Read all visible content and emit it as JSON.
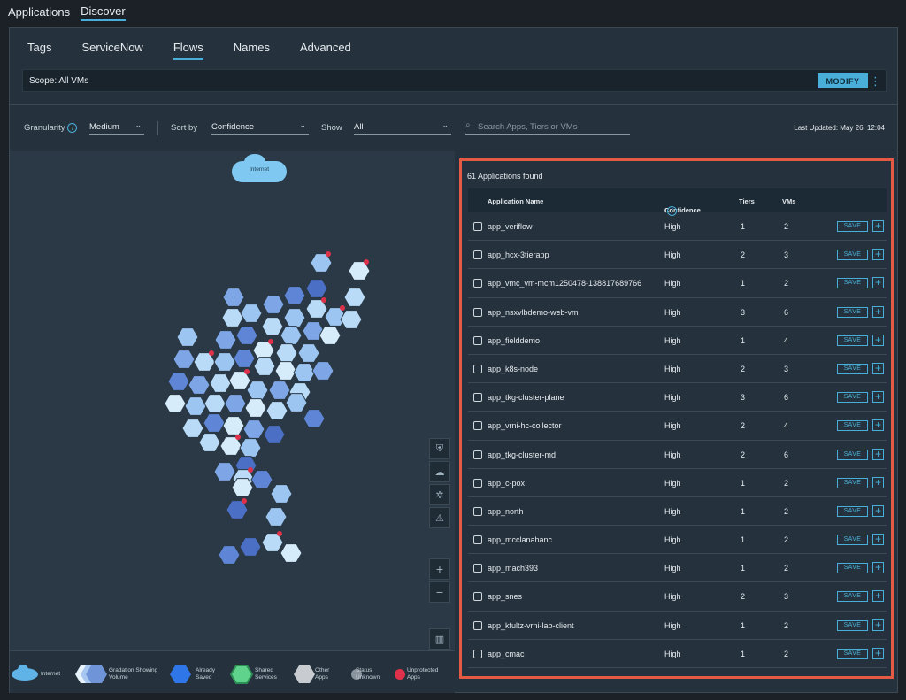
{
  "top_nav": {
    "applications": "Applications",
    "discover": "Discover"
  },
  "tabs": [
    {
      "label": "Tags"
    },
    {
      "label": "ServiceNow"
    },
    {
      "label": "Flows"
    },
    {
      "label": "Names"
    },
    {
      "label": "Advanced"
    }
  ],
  "scope": {
    "label": "Scope: All VMs",
    "modify_label": "MODIFY"
  },
  "filters": {
    "granularity_label": "Granularity",
    "granularity_value": "Medium",
    "sort_label": "Sort by",
    "sort_value": "Confidence",
    "show_label": "Show",
    "show_value": "All",
    "search_placeholder": "Search Apps, Tiers or VMs",
    "last_updated": "Last Updated: May 26, 12:04"
  },
  "map": {
    "internet_label": "Internet"
  },
  "legend": {
    "internet": "Internet",
    "gradation": "Gradation Showing Volume",
    "saved": "Already Saved",
    "shared": "Shared Services",
    "other": "Other Apps",
    "unknown": "Status Unknown",
    "unprotected": "Unprotected Apps"
  },
  "panel": {
    "found": "61 Applications found",
    "headers": {
      "name": "Application Name",
      "confidence": "Confidence",
      "tiers": "Tiers",
      "vms": "VMs"
    },
    "save_label": "SAVE",
    "rows": [
      {
        "name": "app_veriflow",
        "confidence": "High",
        "tiers": "1",
        "vms": "2"
      },
      {
        "name": "app_hcx-3tierapp",
        "confidence": "High",
        "tiers": "2",
        "vms": "3"
      },
      {
        "name": "app_vmc_vm-mcm1250478-138817689766",
        "confidence": "High",
        "tiers": "1",
        "vms": "2"
      },
      {
        "name": "app_nsxvlbdemo-web-vm",
        "confidence": "High",
        "tiers": "3",
        "vms": "6"
      },
      {
        "name": "app_fielddemo",
        "confidence": "High",
        "tiers": "1",
        "vms": "4"
      },
      {
        "name": "app_k8s-node",
        "confidence": "High",
        "tiers": "2",
        "vms": "3"
      },
      {
        "name": "app_tkg-cluster-plane",
        "confidence": "High",
        "tiers": "3",
        "vms": "6"
      },
      {
        "name": "app_vrni-hc-collector",
        "confidence": "High",
        "tiers": "2",
        "vms": "4"
      },
      {
        "name": "app_tkg-cluster-md",
        "confidence": "High",
        "tiers": "2",
        "vms": "6"
      },
      {
        "name": "app_c-pox",
        "confidence": "High",
        "tiers": "1",
        "vms": "2"
      },
      {
        "name": "app_north",
        "confidence": "High",
        "tiers": "1",
        "vms": "2"
      },
      {
        "name": "app_mcclanahanc",
        "confidence": "High",
        "tiers": "1",
        "vms": "2"
      },
      {
        "name": "app_mach393",
        "confidence": "High",
        "tiers": "1",
        "vms": "2"
      },
      {
        "name": "app_snes",
        "confidence": "High",
        "tiers": "2",
        "vms": "3"
      },
      {
        "name": "app_kfultz-vrni-lab-client",
        "confidence": "High",
        "tiers": "1",
        "vms": "2"
      },
      {
        "name": "app_cmac",
        "confidence": "High",
        "tiers": "1",
        "vms": "2"
      }
    ]
  }
}
